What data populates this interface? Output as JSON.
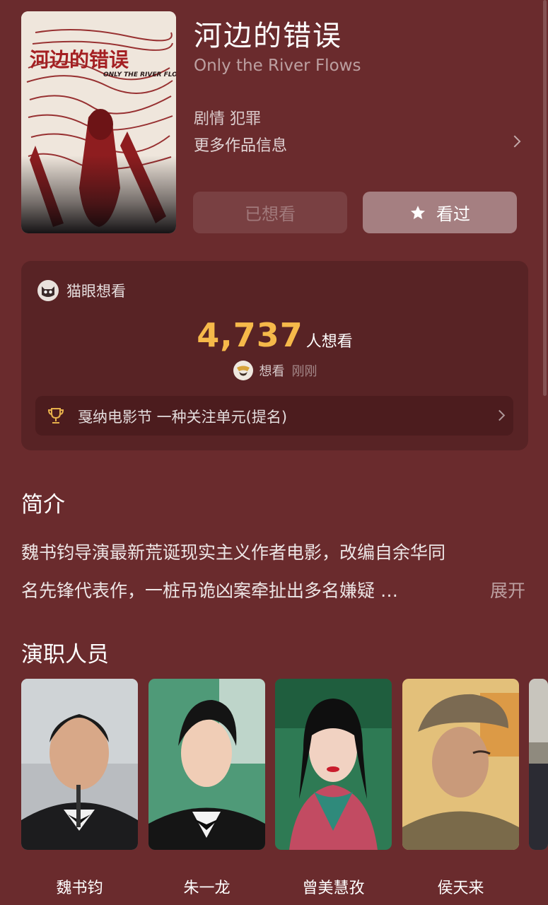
{
  "movie": {
    "title": "河边的错误",
    "english_title": "Only the River Flows",
    "genres": "剧情 犯罪",
    "more_info_label": "更多作品信息",
    "poster_title_text": "河边的错误",
    "poster_english_text": "ONLY THE RIVER FLOWS"
  },
  "actions": {
    "wanted_label": "已想看",
    "seen_label": "看过"
  },
  "maoyan": {
    "label": "猫眼想看",
    "want_count": "4,737",
    "want_suffix": "人想看",
    "recent_action": "想看",
    "recent_time": "刚刚",
    "award": "戛纳电影节 一种关注单元(提名)"
  },
  "synopsis": {
    "heading": "简介",
    "line1": "魏书钧导演最新荒诞现实主义作者电影，改编自余华同",
    "line2": "名先锋代表作，一桩吊诡凶案牵扯出多名嫌疑 …",
    "expand_label": "展开"
  },
  "cast": {
    "heading": "演职人员",
    "members": [
      {
        "name": "魏书钧"
      },
      {
        "name": "朱一龙"
      },
      {
        "name": "曾美慧孜"
      },
      {
        "name": "侯天来"
      }
    ]
  },
  "colors": {
    "background": "#6a2b2d",
    "card": "#582325",
    "accent_count": "#f6b94a"
  },
  "icons": {
    "star": "star-icon",
    "cat": "maoyan-cat-icon",
    "trophy": "trophy-icon",
    "chevron": "chevron-right-icon"
  }
}
